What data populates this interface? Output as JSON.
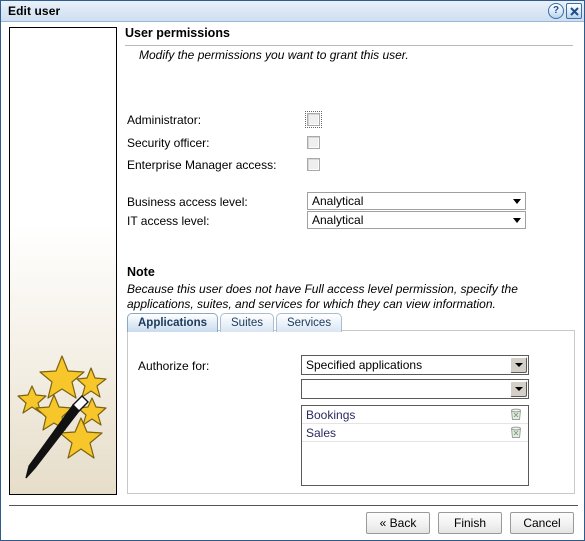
{
  "window": {
    "title": "Edit user",
    "help_label": "?",
    "close_label": "✖"
  },
  "sidebar": {
    "graphic": "magic-wand-with-stars"
  },
  "main": {
    "title": "User permissions",
    "subtitle": "Modify the permissions you want to grant this user.",
    "permissions": [
      {
        "label": "Administrator:",
        "checked": false,
        "focused": true
      },
      {
        "label": "Security officer:",
        "checked": false,
        "focused": false
      },
      {
        "label": "Enterprise Manager access:",
        "checked": false,
        "focused": false
      }
    ],
    "levels": [
      {
        "label": "Business access level:",
        "value": "Analytical"
      },
      {
        "label": "IT access level:",
        "value": "Analytical"
      }
    ],
    "note": {
      "title": "Note",
      "body": "Because this user does not have Full access level permission, specify the applications, suites, and services for which they can view information."
    },
    "tabs": [
      {
        "label": "Applications",
        "active": true
      },
      {
        "label": "Suites",
        "active": false
      },
      {
        "label": "Services",
        "active": false
      }
    ],
    "tab_panel": {
      "authorize_label": "Authorize for:",
      "authorize_value": "Specified applications",
      "add_value": "",
      "items": [
        {
          "name": "Bookings",
          "action_icon": "trash-icon"
        },
        {
          "name": "Sales",
          "action_icon": "trash-icon"
        }
      ]
    }
  },
  "footer": {
    "back": "« Back",
    "finish": "Finish",
    "cancel": "Cancel"
  },
  "colors": {
    "accent": "#2f5c8a",
    "title_gradient_top": "#eaf1fa",
    "sidebar_bottom": "#e6ddc9",
    "star": "#f5c02a",
    "list_text": "#2a2a60"
  }
}
